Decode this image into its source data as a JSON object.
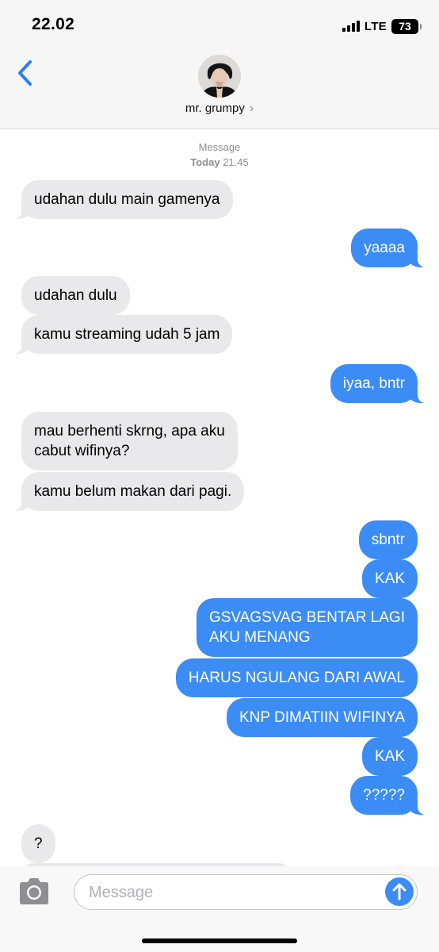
{
  "status_bar": {
    "time": "22.02",
    "network": "LTE",
    "battery": "73"
  },
  "header": {
    "contact_name": "mr. grumpy",
    "chevron": "›"
  },
  "thread": {
    "service_label": "Message",
    "day_label": "Today",
    "time_label": "21.45",
    "messages": [
      {
        "direction": "incoming",
        "text": "udahan dulu main gamenya"
      },
      {
        "direction": "outgoing",
        "text": "yaaaa"
      },
      {
        "direction": "incoming",
        "text": "udahan dulu"
      },
      {
        "direction": "incoming",
        "text": "kamu streaming udah 5 jam"
      },
      {
        "direction": "outgoing",
        "text": "iyaa, bntr"
      },
      {
        "direction": "incoming",
        "lines": [
          "mau berhenti skrng, apa aku",
          "cabut wifinya?"
        ]
      },
      {
        "direction": "incoming",
        "text": "kamu belum makan dari pagi."
      },
      {
        "direction": "outgoing",
        "text": "sbntr"
      },
      {
        "direction": "outgoing",
        "text": "KAK"
      },
      {
        "direction": "outgoing",
        "lines": [
          "GSVAGSVAG BENTAR LAGI",
          "AKU MENANG"
        ]
      },
      {
        "direction": "outgoing",
        "text": "HARUS NGULANG DARI AWAL"
      },
      {
        "direction": "outgoing",
        "text": "KNP DIMATIIN WIFINYA"
      },
      {
        "direction": "outgoing",
        "text": "KAK"
      },
      {
        "direction": "outgoing",
        "text": "?????"
      },
      {
        "direction": "incoming",
        "text": "?"
      }
    ]
  },
  "composer": {
    "placeholder": "Message"
  },
  "icons": {
    "back": "chevron-left-icon",
    "camera": "camera-icon",
    "send": "arrow-up-icon",
    "signal": "cellular-signal-icon",
    "battery": "battery-icon"
  },
  "colors": {
    "accent": "#3b8cf5",
    "incoming_bubble": "#e9e9eb",
    "header_bg": "#f6f6f6"
  }
}
